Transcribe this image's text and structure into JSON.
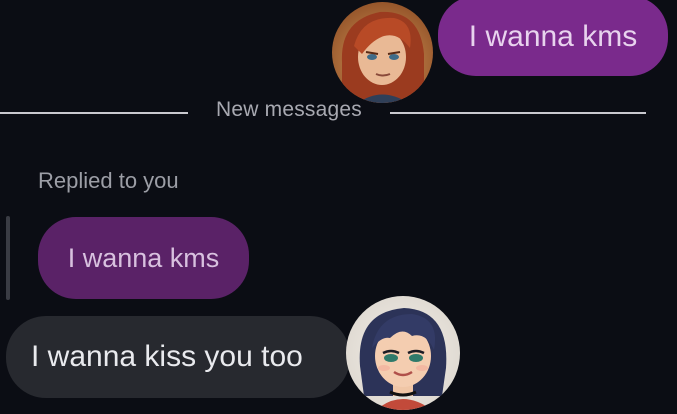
{
  "conversation": {
    "outgoing_message": "I wanna kms",
    "divider_label": "New messages",
    "reply_context_label": "Replied to you",
    "quoted_message": "I wanna kms",
    "incoming_message": "I wanna kiss you too"
  },
  "colors": {
    "background": "#0b0d14",
    "outgoing_bubble": "#7a2a8c",
    "quoted_bubble": "#5a2267",
    "incoming_bubble": "#27292f"
  },
  "avatars": {
    "sender_avatar_icon": "avatar-redhair-icon",
    "contact_avatar_icon": "avatar-bluehair-icon"
  }
}
